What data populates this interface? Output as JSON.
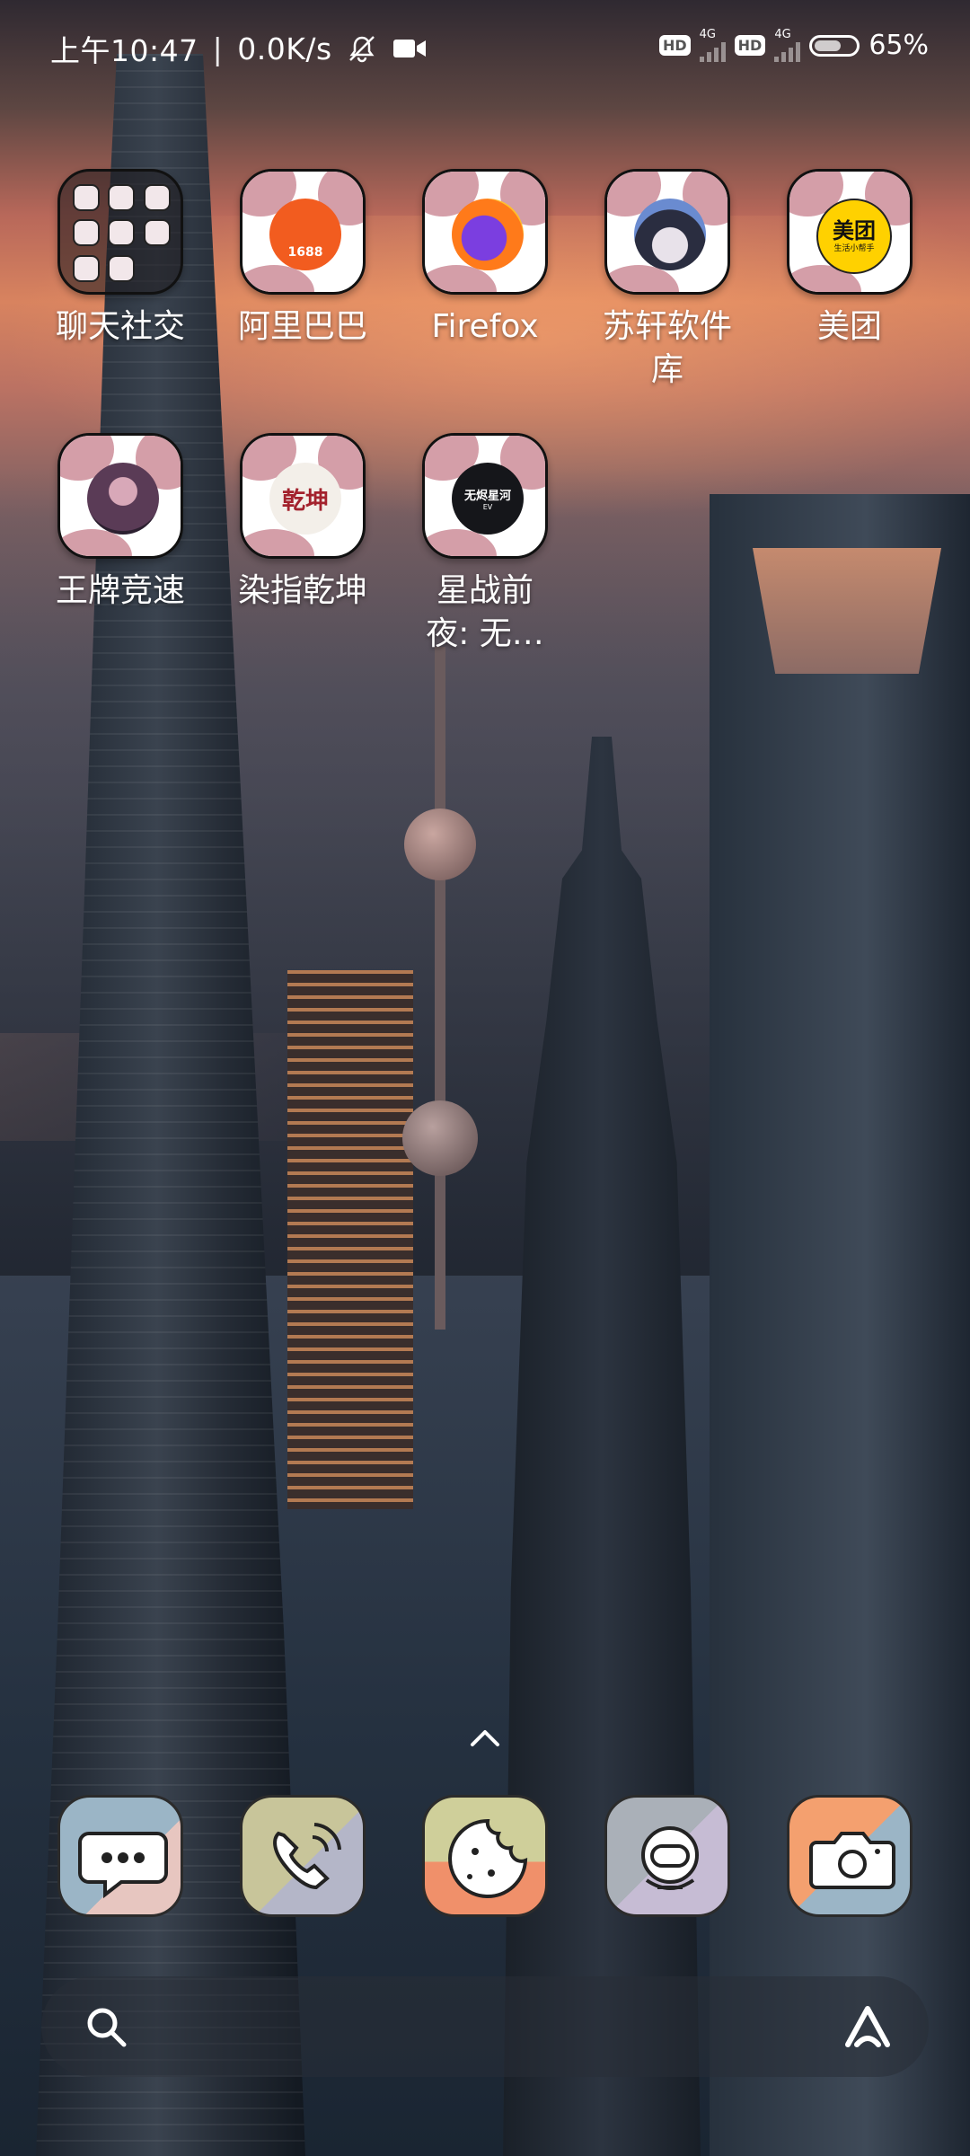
{
  "status_bar": {
    "time": "上午10:47",
    "net_speed": "0.0K/s",
    "sim1": {
      "hd": "HD",
      "tech": "4G"
    },
    "sim2": {
      "hd": "HD",
      "tech": "4G"
    },
    "battery": "65%",
    "battery_level": 0.65,
    "icons": [
      "mute-bell-icon",
      "video-camera-icon"
    ]
  },
  "apps": [
    {
      "label": "聊天社交",
      "type": "folder"
    },
    {
      "label": "阿里巴巴",
      "icon_text": "1688",
      "color": "#f25c1f"
    },
    {
      "label": "Firefox",
      "color": "#7b3ee0"
    },
    {
      "label": "苏轩软件库",
      "color": "#4a4f6a"
    },
    {
      "label": "美团",
      "icon_text": "美团",
      "icon_subtext": "生活小帮手",
      "color": "#ffd100"
    },
    {
      "label": "王牌竞速",
      "color": "#5a3b56"
    },
    {
      "label": "染指乾坤",
      "icon_text": "乾坤",
      "color": "#a3222d"
    },
    {
      "label": "星战前夜: 无…",
      "icon_text": "无烬星河",
      "icon_subtext": "EV",
      "color": "#15161a"
    }
  ],
  "dock": [
    {
      "name": "messages",
      "icon": "chat-bubble-icon"
    },
    {
      "name": "phone",
      "icon": "phone-icon"
    },
    {
      "name": "browser",
      "icon": "cookie-icon"
    },
    {
      "name": "security",
      "icon": "astronaut-icon"
    },
    {
      "name": "camera",
      "icon": "camera-icon"
    }
  ],
  "colors": {
    "icon_blob": "#d49ea8",
    "dock_sage": "#c8c59a",
    "dock_blue": "#9bb5c6",
    "dock_orange": "#f4a06f"
  }
}
